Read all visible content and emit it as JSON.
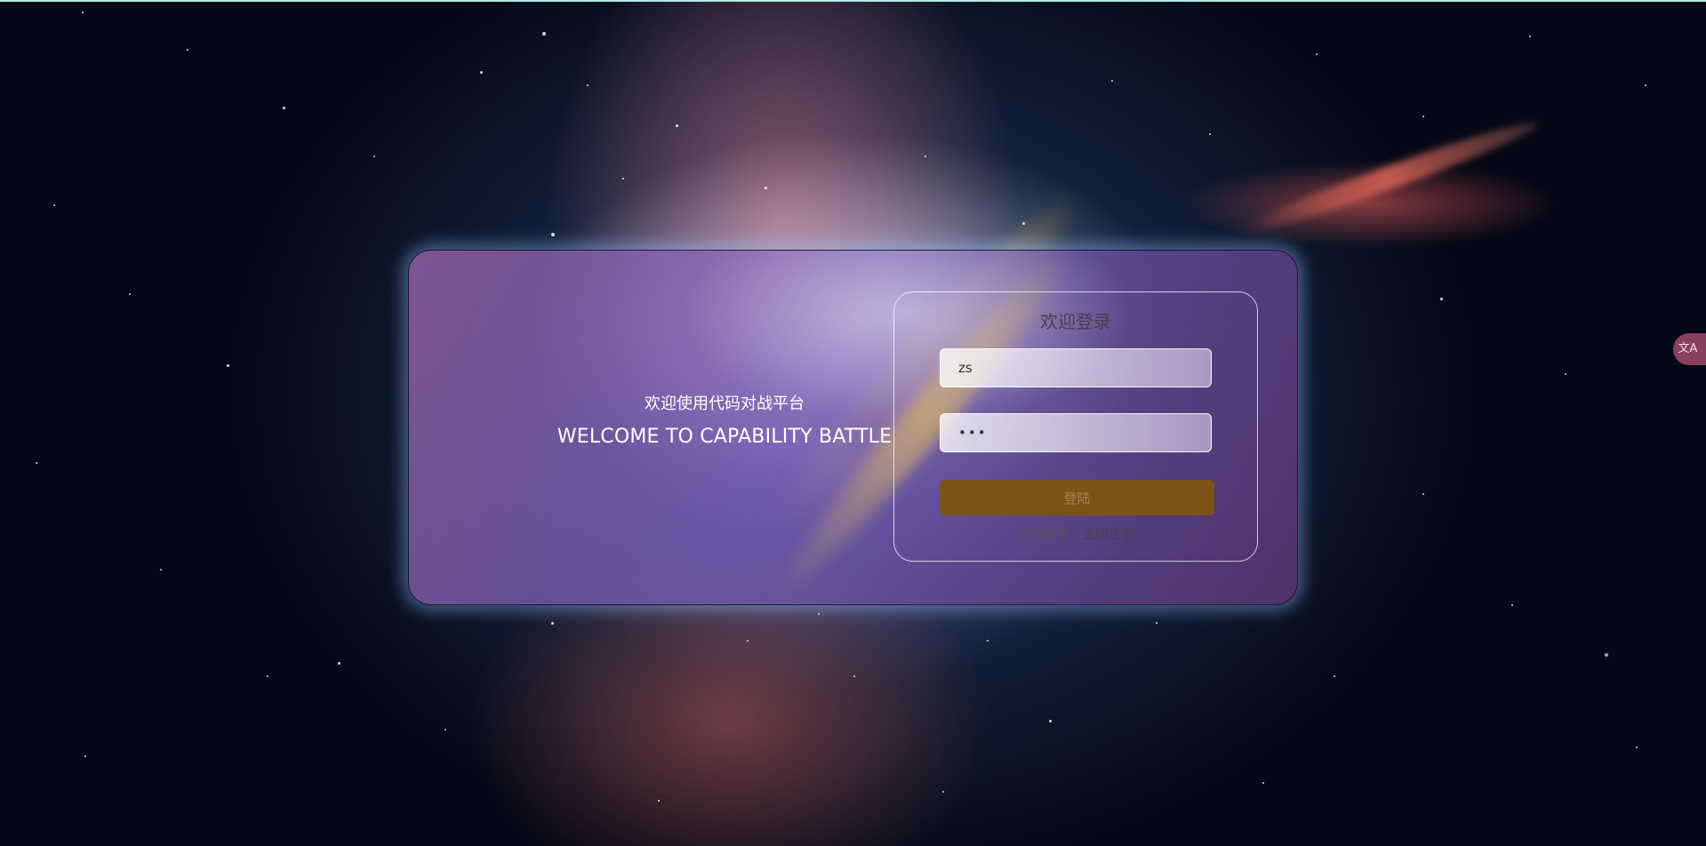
{
  "welcome": {
    "title_cn": "欢迎使用代码对战平台",
    "title_en": "WELCOME TO CAPABILITY BATTLE"
  },
  "login": {
    "title": "欢迎登录",
    "username_value": "zs",
    "password_value": "•••",
    "submit_label": "登陆",
    "register_prompt": "没有账号?",
    "register_link": "立即注册"
  },
  "translate_widget": {
    "icon": "translate-icon",
    "label": "文A"
  },
  "colors": {
    "login_button": "#7c5317",
    "top_bar": "#b7e9e3",
    "translate_tab": "#8a3f5e"
  }
}
